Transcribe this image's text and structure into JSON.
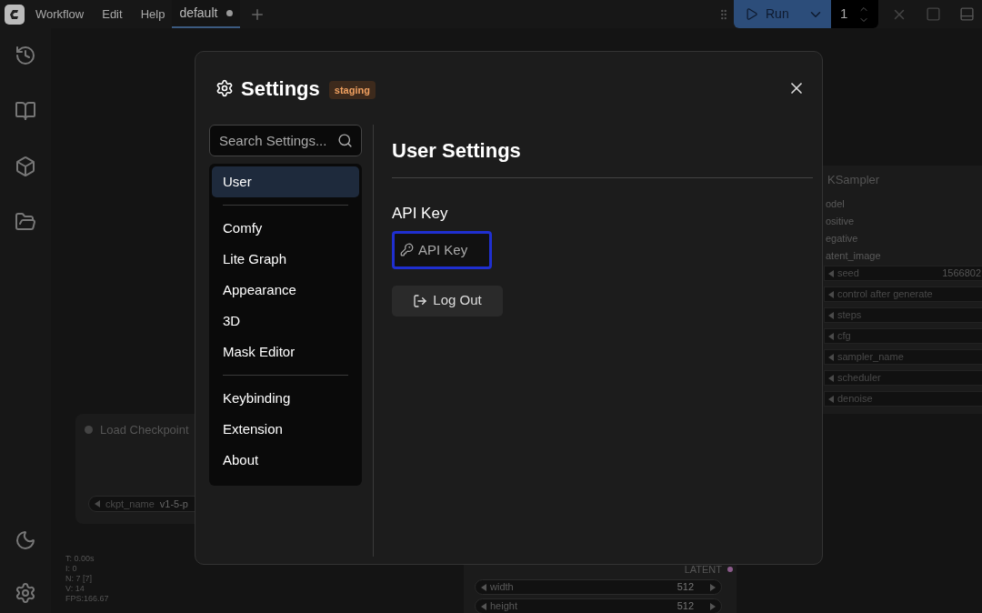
{
  "menubar": {
    "menus": [
      "Workflow",
      "Edit",
      "Help"
    ],
    "tabs": [
      {
        "label": "default",
        "selected": true,
        "modified": true
      }
    ],
    "run_button": "Run",
    "batch_count": "1"
  },
  "canvas": {
    "ksampler": {
      "title": "KSampler",
      "inputs": [
        "odel",
        "ositive",
        "egative",
        "atent_image"
      ],
      "widgets": [
        {
          "label": "seed",
          "value": "1566802"
        },
        {
          "label": "control after generate"
        },
        {
          "label": "steps"
        },
        {
          "label": "cfg"
        },
        {
          "label": "sampler_name"
        },
        {
          "label": "scheduler"
        },
        {
          "label": "denoise"
        }
      ]
    },
    "load_checkpoint": {
      "title": "Load Checkpoint",
      "widget": {
        "label": "ckpt_name",
        "value": "v1-5-p"
      }
    },
    "latent_node": {
      "output": "LATENT",
      "widgets": [
        {
          "label": "width",
          "value": "512"
        },
        {
          "label": "height",
          "value": "512"
        }
      ]
    },
    "stats": [
      "T: 0.00s",
      "I: 0",
      "N: 7 [7]",
      "V: 14",
      "FPS:166.67"
    ]
  },
  "settings": {
    "title": "Settings",
    "badge": "staging",
    "search": {
      "placeholder": "Search Settings..."
    },
    "nav_groups": [
      [
        {
          "label": "User",
          "selected": true
        }
      ],
      [
        {
          "label": "Comfy",
          "selected": false
        },
        {
          "label": "Lite Graph",
          "selected": false
        },
        {
          "label": "Appearance",
          "selected": false
        },
        {
          "label": "3D",
          "selected": false
        },
        {
          "label": "Mask Editor",
          "selected": false
        }
      ],
      [
        {
          "label": "Keybinding",
          "selected": false
        },
        {
          "label": "Extension",
          "selected": false
        },
        {
          "label": "About",
          "selected": false
        }
      ]
    ],
    "heading": "User Settings",
    "api_key": {
      "label": "API Key",
      "placeholder": "API Key",
      "focused": true
    },
    "logout_button": "Log Out"
  }
}
